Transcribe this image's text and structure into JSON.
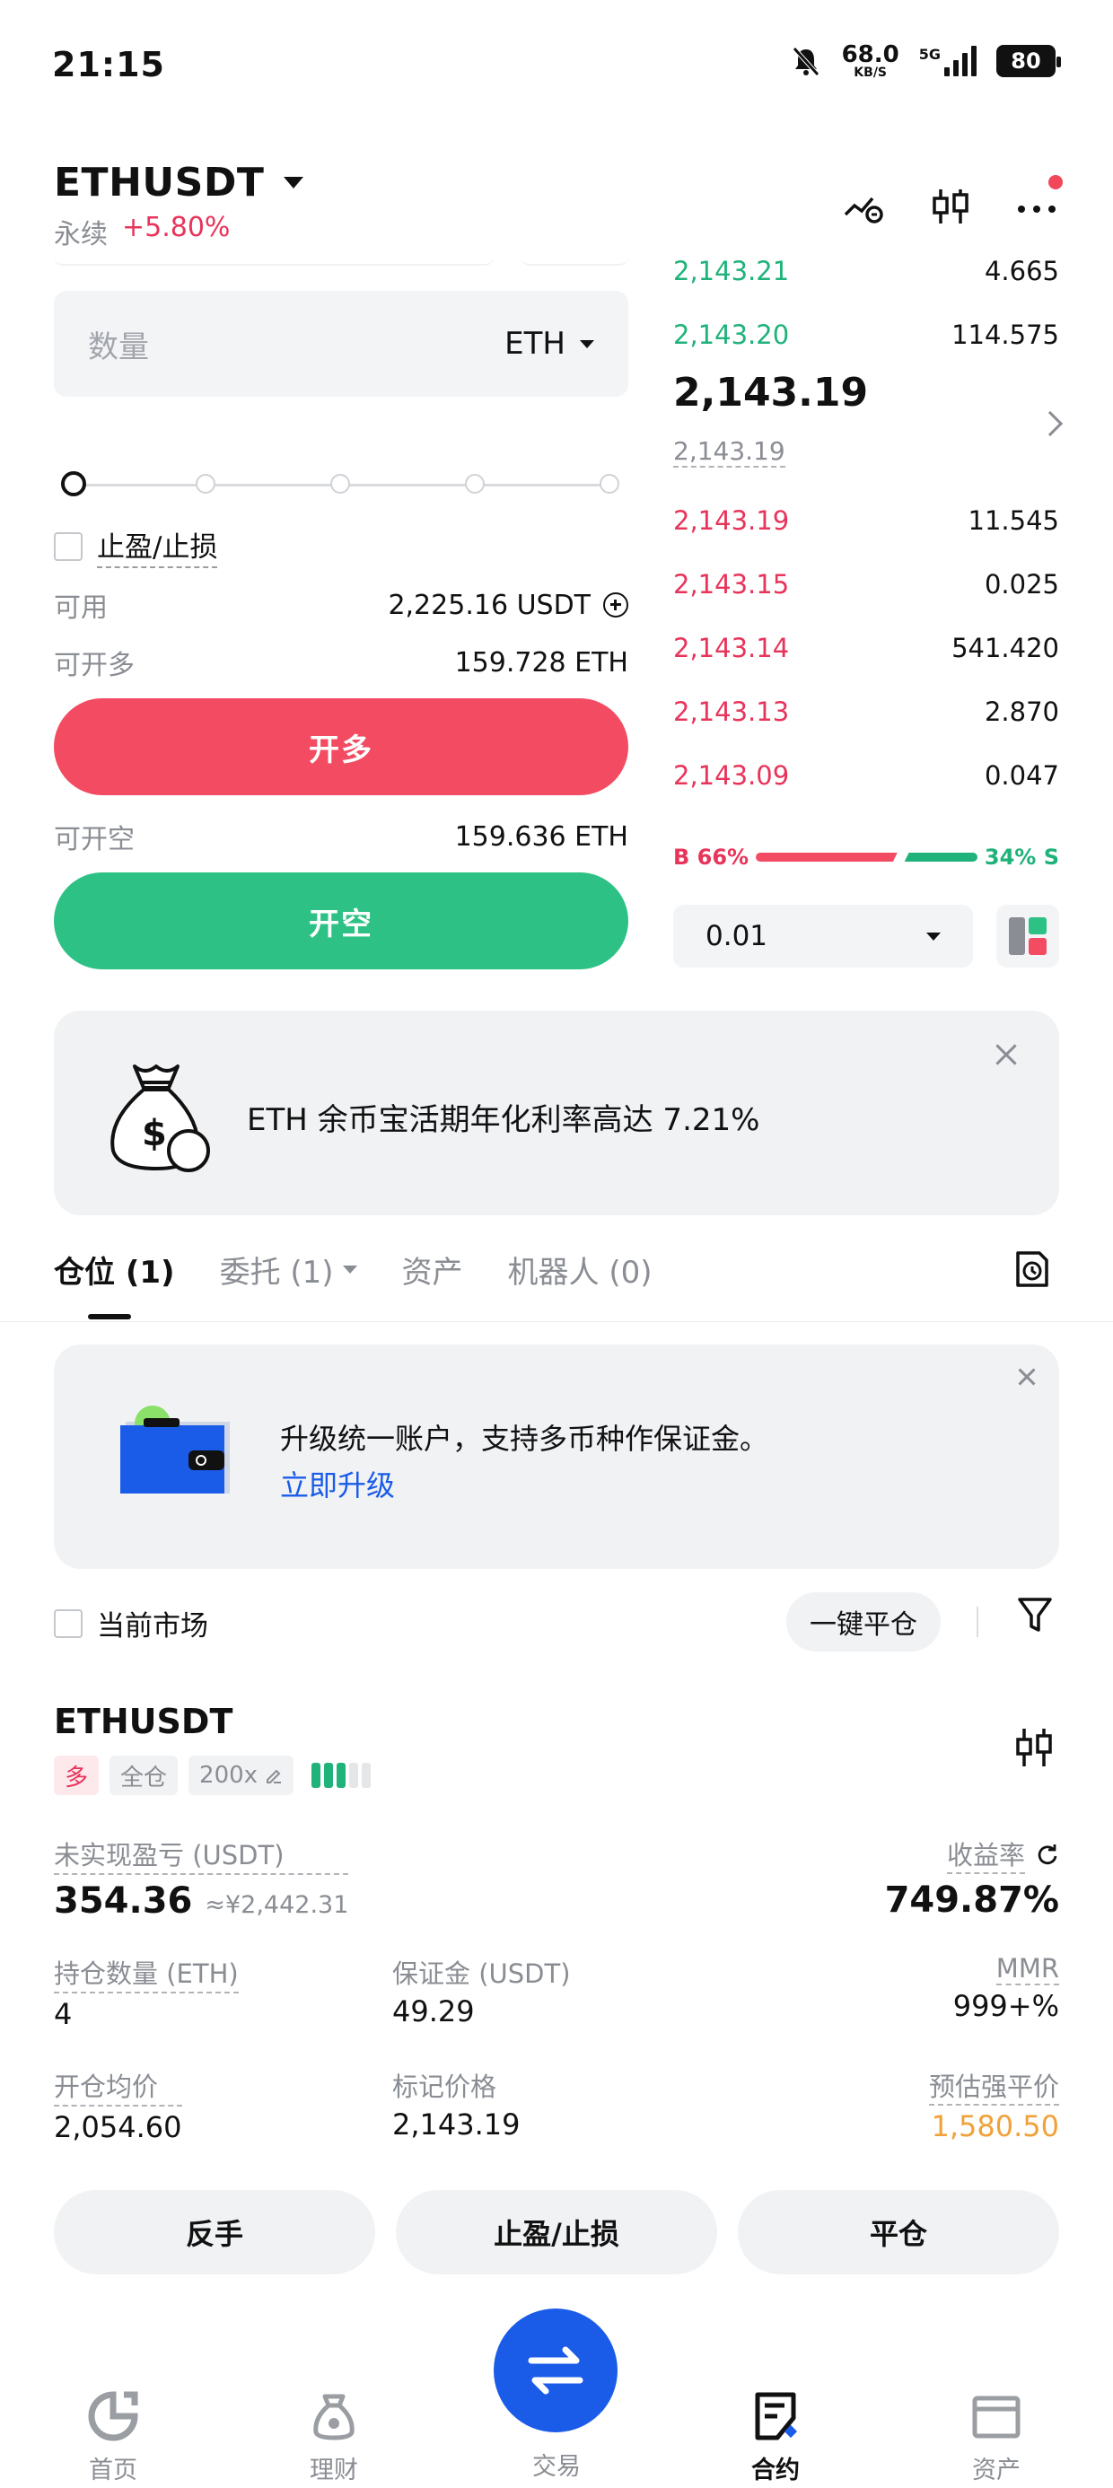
{
  "status_bar": {
    "time": "21:15",
    "net_speed": "68.0",
    "net_unit": "KB/S",
    "network": "5G",
    "battery": "80"
  },
  "header": {
    "symbol": "ETHUSDT",
    "contract_type": "永续",
    "change": "+5.80%",
    "icons": [
      "price-alert-icon",
      "candlestick-chart-icon",
      "more-icon"
    ]
  },
  "order_form": {
    "quantity_placeholder": "数量",
    "quantity_unit": "ETH",
    "slider_value": 0,
    "tp_sl_label": "止盈/止损",
    "available_label": "可用",
    "available_value": "2,225.16 USDT",
    "max_long_label": "可开多",
    "max_long_value": "159.728 ETH",
    "open_long_label": "开多",
    "max_short_label": "可开空",
    "max_short_value": "159.636 ETH",
    "open_short_label": "开空"
  },
  "order_book": {
    "asks": [
      {
        "price": "2,143.21",
        "amount": "4.665",
        "depth": 0.15
      },
      {
        "price": "2,143.20",
        "amount": "114.575",
        "depth": 0.15
      }
    ],
    "last_price": "2,143.19",
    "mark_price": "2,143.19",
    "bids": [
      {
        "price": "2,143.19",
        "amount": "11.545",
        "depth": 0.05
      },
      {
        "price": "2,143.15",
        "amount": "0.025",
        "depth": 0.05
      },
      {
        "price": "2,143.14",
        "amount": "541.420",
        "depth": 0.34
      },
      {
        "price": "2,143.13",
        "amount": "2.870",
        "depth": 0.34
      },
      {
        "price": "2,143.09",
        "amount": "0.047",
        "depth": 0.34
      }
    ],
    "buy_ratio": "B 66%",
    "sell_ratio": "34% S",
    "precision": "0.01"
  },
  "promo": {
    "text": "ETH 余币宝活期年化利率高达 7.21%"
  },
  "tabs": [
    {
      "label": "仓位 (1)",
      "active": true
    },
    {
      "label": "委托 (1)",
      "active": false,
      "dropdown": true
    },
    {
      "label": "资产",
      "active": false
    },
    {
      "label": "机器人 (0)",
      "active": false
    }
  ],
  "upgrade": {
    "text": "升级统一账户，支持多币种作保证金。",
    "link": "立即升级"
  },
  "filters": {
    "current_market": "当前市场",
    "close_all": "一键平仓"
  },
  "position": {
    "symbol": "ETHUSDT",
    "side": "多",
    "margin_mode": "全仓",
    "leverage": "200x",
    "adl_level": 3,
    "unrealized_pnl_label": "未实现盈亏 (USDT)",
    "unrealized_pnl": "354.36",
    "unrealized_pnl_cny": "≈¥2,442.31",
    "roe_label": "收益率",
    "roe": "749.87%",
    "size_label": "持仓数量 (ETH)",
    "size": "4",
    "margin_label": "保证金 (USDT)",
    "margin": "49.29",
    "mmr_label": "MMR",
    "mmr": "999+%",
    "entry_label": "开仓均价",
    "entry": "2,054.60",
    "mark_label": "标记价格",
    "mark": "2,143.19",
    "liq_label": "预估强平价",
    "liq": "1,580.50",
    "btn_reverse": "反手",
    "btn_tpsl": "止盈/止损",
    "btn_close": "平仓"
  },
  "bottom_nav": [
    {
      "label": "首页",
      "icon": "home-icon"
    },
    {
      "label": "理财",
      "icon": "finance-icon"
    },
    {
      "label": "交易",
      "icon": "trade-icon"
    },
    {
      "label": "合约",
      "icon": "futures-icon",
      "active": true
    },
    {
      "label": "资产",
      "icon": "assets-icon"
    }
  ],
  "colors": {
    "long": "#f24b62",
    "short": "#2ec185",
    "accent": "#1a5ce8",
    "liq": "#f0a23a"
  }
}
